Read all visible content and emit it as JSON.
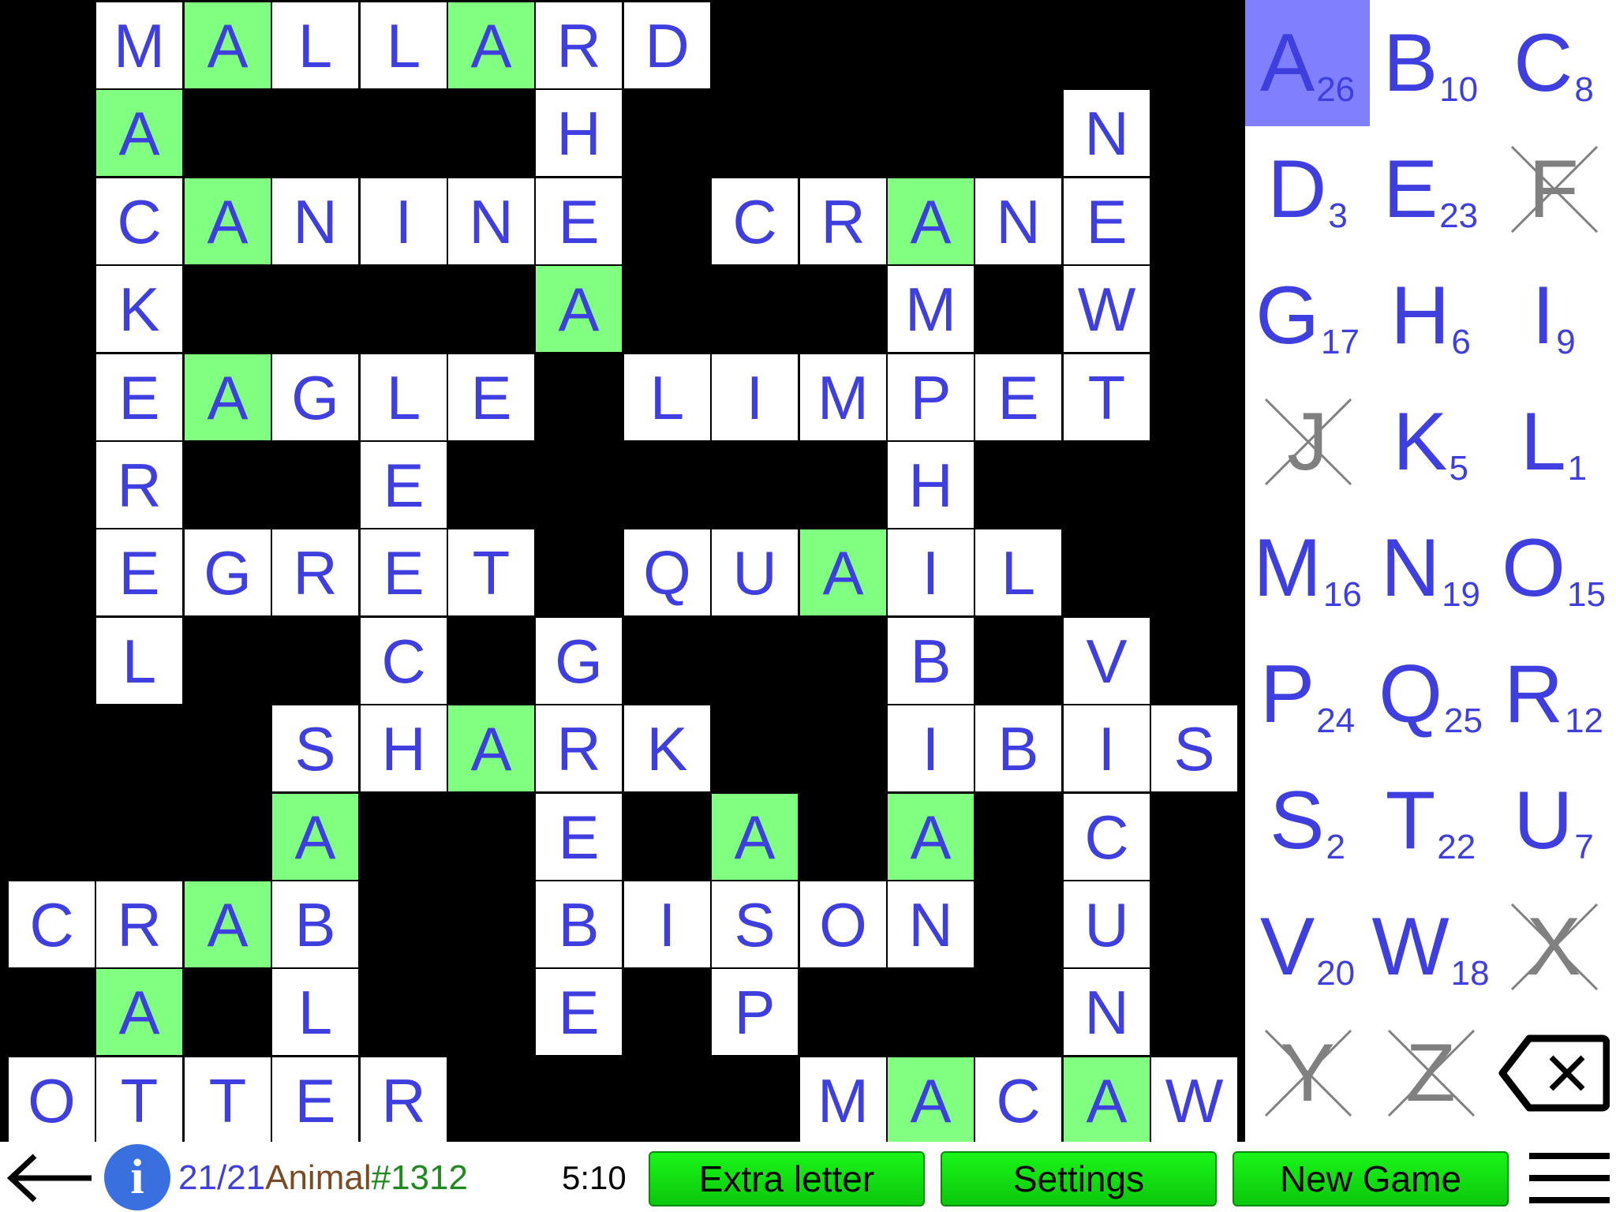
{
  "colors": {
    "letter": "#3f3fdf",
    "highlight": "#80ff80",
    "selected_key": "#8080ff",
    "used_key": "#808080",
    "button_green": "#19f519",
    "score": "#3f3fdf",
    "category": "#7b4b24",
    "puzzle_number": "#1f8a1f"
  },
  "board": {
    "cols": 14,
    "rows": 13,
    "grid": [
      ".MALLARD......",
      ".A....H.....N.",
      ".CANINE.CRANE.",
      ".K....A...M.W.",
      ".EAGLE.LIMPET.",
      ".R..E.....H...",
      ".EGRET.QUAIL..",
      ".L..C.G...B.V.",
      "...SHARK..IBIS",
      "...A..E.A.A.C.",
      "CRAB..BISON.U.",
      ".A.L..E.P...N.",
      "OTTER....MACAW"
    ],
    "highlight_letter": "A"
  },
  "keyboard": {
    "keys": [
      {
        "letter": "A",
        "num": "26",
        "state": "selected"
      },
      {
        "letter": "B",
        "num": "10",
        "state": "normal"
      },
      {
        "letter": "C",
        "num": "8",
        "state": "normal"
      },
      {
        "letter": "D",
        "num": "3",
        "state": "normal"
      },
      {
        "letter": "E",
        "num": "23",
        "state": "normal"
      },
      {
        "letter": "F",
        "num": "",
        "state": "used"
      },
      {
        "letter": "G",
        "num": "17",
        "state": "normal"
      },
      {
        "letter": "H",
        "num": "6",
        "state": "normal"
      },
      {
        "letter": "I",
        "num": "9",
        "state": "normal"
      },
      {
        "letter": "J",
        "num": "",
        "state": "used"
      },
      {
        "letter": "K",
        "num": "5",
        "state": "normal"
      },
      {
        "letter": "L",
        "num": "1",
        "state": "normal"
      },
      {
        "letter": "M",
        "num": "16",
        "state": "normal"
      },
      {
        "letter": "N",
        "num": "19",
        "state": "normal"
      },
      {
        "letter": "O",
        "num": "15",
        "state": "normal"
      },
      {
        "letter": "P",
        "num": "24",
        "state": "normal"
      },
      {
        "letter": "Q",
        "num": "25",
        "state": "normal"
      },
      {
        "letter": "R",
        "num": "12",
        "state": "normal"
      },
      {
        "letter": "S",
        "num": "2",
        "state": "normal"
      },
      {
        "letter": "T",
        "num": "22",
        "state": "normal"
      },
      {
        "letter": "U",
        "num": "7",
        "state": "normal"
      },
      {
        "letter": "V",
        "num": "20",
        "state": "normal"
      },
      {
        "letter": "W",
        "num": "18",
        "state": "normal"
      },
      {
        "letter": "X",
        "num": "",
        "state": "used"
      },
      {
        "letter": "Y",
        "num": "",
        "state": "used"
      },
      {
        "letter": "Z",
        "num": "",
        "state": "used"
      }
    ],
    "backspace_icon": "backspace-icon"
  },
  "status": {
    "back_icon": "arrow-left-icon",
    "info_icon": "info-icon",
    "info_glyph": "i",
    "score": "21/21",
    "category": "Animal",
    "puzzle_number": "#1312",
    "timer": "5:10",
    "menu_icon": "hamburger-menu-icon"
  },
  "buttons": {
    "extra_letter": "Extra letter",
    "settings": "Settings",
    "new_game": "New Game"
  }
}
